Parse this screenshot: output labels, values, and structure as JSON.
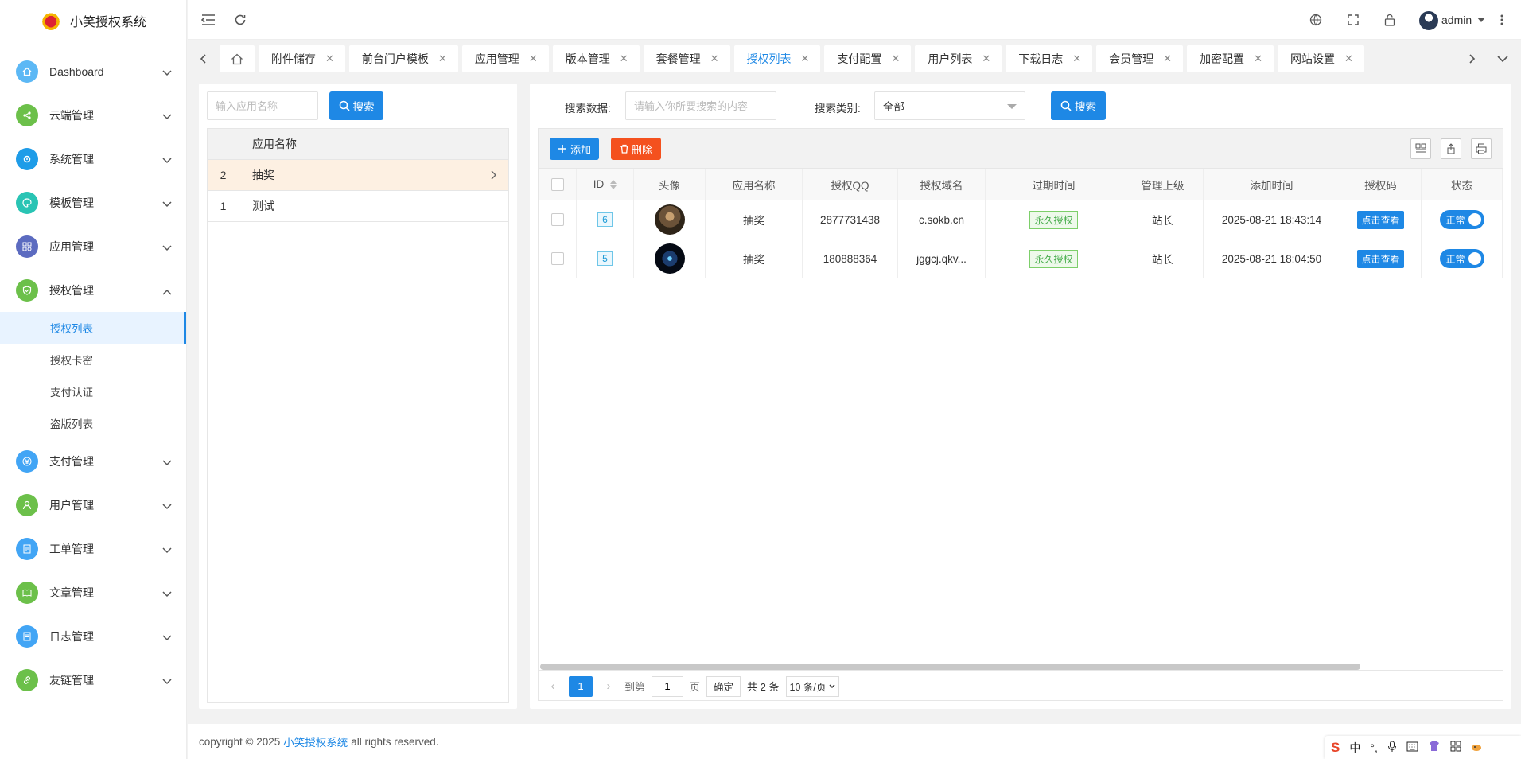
{
  "app": {
    "title": "小笑授权系统"
  },
  "header": {
    "username": "admin"
  },
  "sidebar": {
    "items": [
      {
        "label": "Dashboard",
        "icon": "home-icon",
        "color": "#5cb8f5",
        "expanded": false
      },
      {
        "label": "云端管理",
        "icon": "share-icon",
        "color": "#6cc04a",
        "expanded": false
      },
      {
        "label": "系统管理",
        "icon": "gear-icon",
        "color": "#1e9ce8",
        "expanded": false
      },
      {
        "label": "模板管理",
        "icon": "palette-icon",
        "color": "#29c4b4",
        "expanded": false
      },
      {
        "label": "应用管理",
        "icon": "apps-icon",
        "color": "#5c6bc0",
        "expanded": false
      },
      {
        "label": "授权管理",
        "icon": "shield-icon",
        "color": "#6cc04a",
        "expanded": true,
        "children": [
          "授权列表",
          "授权卡密",
          "支付认证",
          "盗版列表"
        ]
      },
      {
        "label": "支付管理",
        "icon": "yen-icon",
        "color": "#42a5f5",
        "expanded": false
      },
      {
        "label": "用户管理",
        "icon": "user-icon",
        "color": "#6cc04a",
        "expanded": false
      },
      {
        "label": "工单管理",
        "icon": "ticket-icon",
        "color": "#42a5f5",
        "expanded": false
      },
      {
        "label": "文章管理",
        "icon": "book-icon",
        "color": "#6cc04a",
        "expanded": false
      },
      {
        "label": "日志管理",
        "icon": "log-icon",
        "color": "#42a5f5",
        "expanded": false
      },
      {
        "label": "友链管理",
        "icon": "link-icon",
        "color": "#6cc04a",
        "expanded": false
      }
    ],
    "active_child": "授权列表"
  },
  "tabs": [
    {
      "label": "附件储存"
    },
    {
      "label": "前台门户模板"
    },
    {
      "label": "应用管理"
    },
    {
      "label": "版本管理"
    },
    {
      "label": "套餐管理"
    },
    {
      "label": "授权列表",
      "active": true
    },
    {
      "label": "支付配置"
    },
    {
      "label": "用户列表"
    },
    {
      "label": "下载日志"
    },
    {
      "label": "会员管理"
    },
    {
      "label": "加密配置"
    },
    {
      "label": "网站设置"
    }
  ],
  "left_panel": {
    "search_placeholder": "输入应用名称",
    "search_button": "搜索",
    "column_header": "应用名称",
    "rows": [
      {
        "num": "2",
        "name": "抽奖",
        "selected": true
      },
      {
        "num": "1",
        "name": "测试",
        "selected": false
      }
    ]
  },
  "right_panel": {
    "search_data_label": "搜索数据:",
    "search_data_placeholder": "请输入你所要搜索的内容",
    "search_type_label": "搜索类别:",
    "search_type_value": "全部",
    "search_button": "搜索",
    "add_button": "添加",
    "delete_button": "删除",
    "columns": [
      "ID",
      "头像",
      "应用名称",
      "授权QQ",
      "授权域名",
      "过期时间",
      "管理上级",
      "添加时间",
      "授权码",
      "状态"
    ],
    "rows": [
      {
        "id": "6",
        "avatar": "warrior",
        "app": "抽奖",
        "qq": "2877731438",
        "domain": "c.sokb.cn",
        "expire": "永久授权",
        "superior": "站长",
        "added": "2025-08-21 18:43:14",
        "code_button": "点击查看",
        "status": "正常"
      },
      {
        "id": "5",
        "avatar": "night",
        "app": "抽奖",
        "qq": "180888364",
        "domain": "jggcj.qkv...",
        "expire": "永久授权",
        "superior": "站长",
        "added": "2025-08-21 18:04:50",
        "code_button": "点击查看",
        "status": "正常"
      }
    ],
    "pagination": {
      "current": "1",
      "goto_label": "到第",
      "goto_value": "1",
      "page_unit": "页",
      "confirm": "确定",
      "total": "共 2 条",
      "page_size": "10 条/页"
    }
  },
  "footer": {
    "prefix": "copyright © 2025",
    "link": "小笑授权系统",
    "suffix": "all rights reserved."
  },
  "ime": {
    "mode": "中"
  }
}
